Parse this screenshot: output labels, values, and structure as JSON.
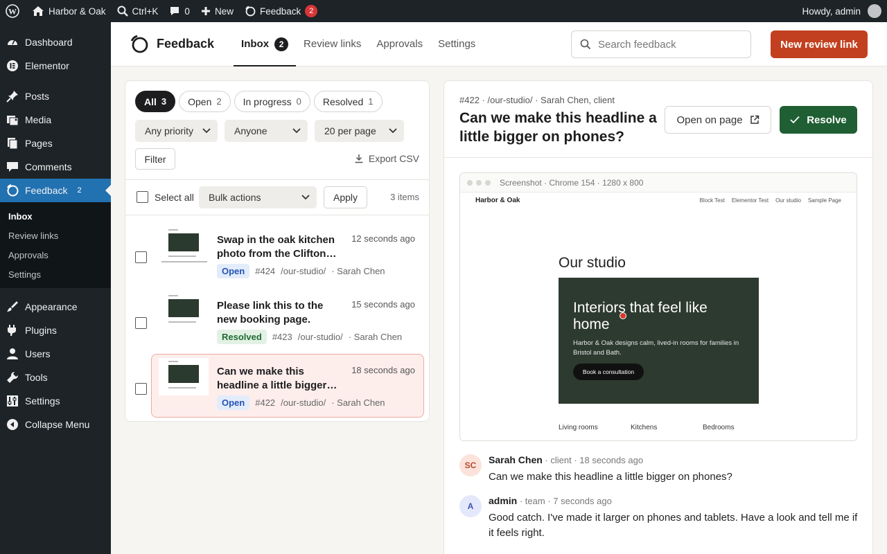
{
  "adminbar": {
    "site_name": "Harbor & Oak",
    "search_shortcut": "Ctrl+K",
    "comments_count": "0",
    "new_label": "New",
    "feedback_label": "Feedback",
    "feedback_count": "2",
    "howdy": "Howdy, admin"
  },
  "sidebar": {
    "items": [
      {
        "label": "Dashboard",
        "icon": "dashboard-icon"
      },
      {
        "label": "Elementor",
        "icon": "elementor-icon"
      },
      {
        "label": "Posts",
        "icon": "pin-icon"
      },
      {
        "label": "Media",
        "icon": "media-icon"
      },
      {
        "label": "Pages",
        "icon": "pages-icon"
      },
      {
        "label": "Comments",
        "icon": "comment-icon"
      },
      {
        "label": "Feedback",
        "icon": "feedback-logo-icon",
        "badge": "2"
      },
      {
        "label": "Appearance",
        "icon": "brush-icon"
      },
      {
        "label": "Plugins",
        "icon": "plugin-icon"
      },
      {
        "label": "Users",
        "icon": "user-icon"
      },
      {
        "label": "Tools",
        "icon": "wrench-icon"
      },
      {
        "label": "Settings",
        "icon": "settings-icon"
      },
      {
        "label": "Collapse Menu",
        "icon": "collapse-icon"
      }
    ],
    "submenu": [
      "Inbox",
      "Review links",
      "Approvals",
      "Settings"
    ]
  },
  "header": {
    "brand": "Feedback",
    "tabs": [
      {
        "label": "Inbox",
        "badge": "2"
      },
      {
        "label": "Review links"
      },
      {
        "label": "Approvals"
      },
      {
        "label": "Settings"
      }
    ],
    "search_placeholder": "Search feedback",
    "new_button": "New review link"
  },
  "list": {
    "chips": [
      {
        "label": "All",
        "count": "3"
      },
      {
        "label": "Open",
        "count": "2"
      },
      {
        "label": "In progress",
        "count": "0"
      },
      {
        "label": "Resolved",
        "count": "1"
      }
    ],
    "priority_select": "Any priority",
    "assignee_select": "Anyone",
    "per_page_select": "20 per page",
    "filter_button": "Filter",
    "export_label": "Export CSV",
    "select_all": "Select all",
    "bulk_select": "Bulk actions",
    "apply_button": "Apply",
    "items_count": "3 items",
    "items": [
      {
        "title": "Swap in the oak kitchen photo from the Clifton shoot",
        "time": "12 seconds ago",
        "status": "Open",
        "id": "#424",
        "path": "/our-studio/",
        "author": "· Sarah Chen"
      },
      {
        "title": "Please link this to the new booking page.",
        "time": "15 seconds ago",
        "status": "Resolved",
        "id": "#423",
        "path": "/our-studio/",
        "author": "· Sarah Chen"
      },
      {
        "title": "Can we make this headline a little bigger on phones?",
        "time": "18 seconds ago",
        "status": "Open",
        "id": "#422",
        "path": "/our-studio/",
        "author": "· Sarah Chen"
      }
    ]
  },
  "detail": {
    "meta": "#422 · /our-studio/ · Sarah Chen, client",
    "title": "Can we make this headline a little bigger on phones?",
    "open_on_page": "Open on page",
    "resolve": "Resolve",
    "screenshot": {
      "caption": "Screenshot · Chrome 154 · 1280 x 800",
      "site_name": "Harbor & Oak",
      "nav": [
        "Block Test",
        "Elementor Test",
        "Our studio",
        "Sample Page"
      ],
      "heading": "Our studio",
      "hero_heading": "Interiors that feel like home",
      "hero_text": "Harbor & Oak designs calm, lived-in rooms for families in Bristol and Bath.",
      "hero_button": "Book a consultation",
      "categories": [
        "Living rooms",
        "Kitchens",
        "Bedrooms"
      ]
    },
    "comments": [
      {
        "initials": "SC",
        "name": "Sarah Chen",
        "role": " · client · 18 seconds ago",
        "text": "Can we make this headline a little bigger on phones?"
      },
      {
        "initials": "A",
        "name": "admin",
        "role": " · team · 7 seconds ago",
        "text": "Good catch. I've made it larger on phones and tablets. Have a look and tell me if it feels right."
      }
    ]
  },
  "colors": {
    "accent": "#c2401f",
    "resolve": "#1f5f33",
    "wp_blue": "#2271b1",
    "admin_dark": "#1d2327"
  }
}
